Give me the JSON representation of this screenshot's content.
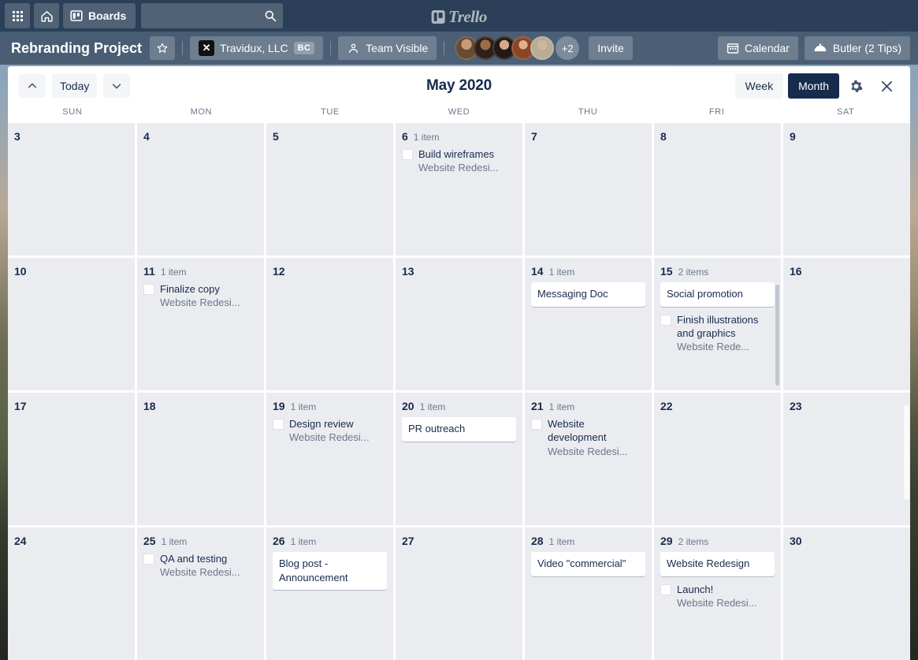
{
  "topnav": {
    "apps_icon": "grid-apps-icon",
    "home_icon": "home-icon",
    "boards_label": "Boards",
    "boards_icon": "board-icon",
    "search_placeholder": "",
    "search_value": "",
    "search_icon": "search-icon",
    "logo_text": "Trello"
  },
  "board": {
    "title": "Rebranding Project",
    "star_icon": "star-icon",
    "team_name": "Travidux, LLC",
    "team_logo_glyph": "✕",
    "team_badge": "BC",
    "visibility_label": "Team Visible",
    "visibility_icon": "team-people-icon",
    "members_overflow": "+2",
    "invite_label": "Invite",
    "calendar_label": "Calendar",
    "calendar_icon": "calendar-icon",
    "butler_label": "Butler (2 Tips)",
    "butler_icon": "butler-dome-icon",
    "avatar_colors": [
      "#8a6a4e",
      "#5c4433",
      "#3b2f28",
      "#a15f3c",
      "#cbb89a"
    ]
  },
  "calendar": {
    "prev_icon": "chevron-up-icon",
    "today_label": "Today",
    "next_icon": "chevron-down-icon",
    "title": "May 2020",
    "view_week_label": "Week",
    "view_month_label": "Month",
    "active_view": "Month",
    "settings_icon": "gear-icon",
    "close_icon": "close-icon",
    "weekdays": [
      "SUN",
      "MON",
      "TUE",
      "WED",
      "THU",
      "FRI",
      "SAT"
    ],
    "list_name_truncated": "Website Redesi...",
    "list_name_truncated_short": "Website Rede...",
    "days": [
      {
        "num": "3",
        "count": "",
        "cards": [],
        "checks": []
      },
      {
        "num": "4",
        "count": "",
        "cards": [],
        "checks": []
      },
      {
        "num": "5",
        "count": "",
        "cards": [],
        "checks": []
      },
      {
        "num": "6",
        "count": "1 item",
        "cards": [],
        "checks": [
          {
            "title": "Build wireframes",
            "sub": "Website Redesi..."
          }
        ]
      },
      {
        "num": "7",
        "count": "",
        "cards": [],
        "checks": []
      },
      {
        "num": "8",
        "count": "",
        "cards": [],
        "checks": []
      },
      {
        "num": "9",
        "count": "",
        "cards": [],
        "checks": []
      },
      {
        "num": "10",
        "count": "",
        "cards": [],
        "checks": []
      },
      {
        "num": "11",
        "count": "1 item",
        "cards": [],
        "checks": [
          {
            "title": "Finalize copy",
            "sub": "Website Redesi..."
          }
        ]
      },
      {
        "num": "12",
        "count": "",
        "cards": [],
        "checks": []
      },
      {
        "num": "13",
        "count": "",
        "cards": [],
        "checks": []
      },
      {
        "num": "14",
        "count": "1 item",
        "cards": [
          "Messaging Doc"
        ],
        "checks": []
      },
      {
        "num": "15",
        "count": "2 items",
        "cards": [
          "Social promotion"
        ],
        "checks": [
          {
            "title": "Finish illustrations and graphics",
            "sub": "Website Rede..."
          }
        ],
        "scroll": true
      },
      {
        "num": "16",
        "count": "",
        "cards": [],
        "checks": []
      },
      {
        "num": "17",
        "count": "",
        "cards": [],
        "checks": []
      },
      {
        "num": "18",
        "count": "",
        "cards": [],
        "checks": []
      },
      {
        "num": "19",
        "count": "1 item",
        "cards": [],
        "checks": [
          {
            "title": "Design review",
            "sub": "Website Redesi..."
          }
        ]
      },
      {
        "num": "20",
        "count": "1 item",
        "cards": [
          "PR outreach"
        ],
        "checks": []
      },
      {
        "num": "21",
        "count": "1 item",
        "cards": [],
        "checks": [
          {
            "title": "Website development",
            "sub": "Website Redesi..."
          }
        ]
      },
      {
        "num": "22",
        "count": "",
        "cards": [],
        "checks": []
      },
      {
        "num": "23",
        "count": "",
        "cards": [],
        "checks": []
      },
      {
        "num": "24",
        "count": "",
        "cards": [],
        "checks": []
      },
      {
        "num": "25",
        "count": "1 item",
        "cards": [],
        "checks": [
          {
            "title": "QA and testing",
            "sub": "Website Redesi..."
          }
        ]
      },
      {
        "num": "26",
        "count": "1 item",
        "cards": [
          "Blog post - Announcement"
        ],
        "checks": []
      },
      {
        "num": "27",
        "count": "",
        "cards": [],
        "checks": []
      },
      {
        "num": "28",
        "count": "1 item",
        "cards": [
          "Video \"commercial\""
        ],
        "checks": []
      },
      {
        "num": "29",
        "count": "2 items",
        "cards": [
          "Website Redesign"
        ],
        "checks": [
          {
            "title": "Launch!",
            "sub": "Website Redesi..."
          }
        ]
      },
      {
        "num": "30",
        "count": "",
        "cards": [],
        "checks": []
      }
    ]
  },
  "colors": {
    "nav_bg": "#2b4058",
    "cell_bg": "#ebecf0",
    "accent_dark": "#172b4d",
    "muted_text": "#6b778c"
  }
}
